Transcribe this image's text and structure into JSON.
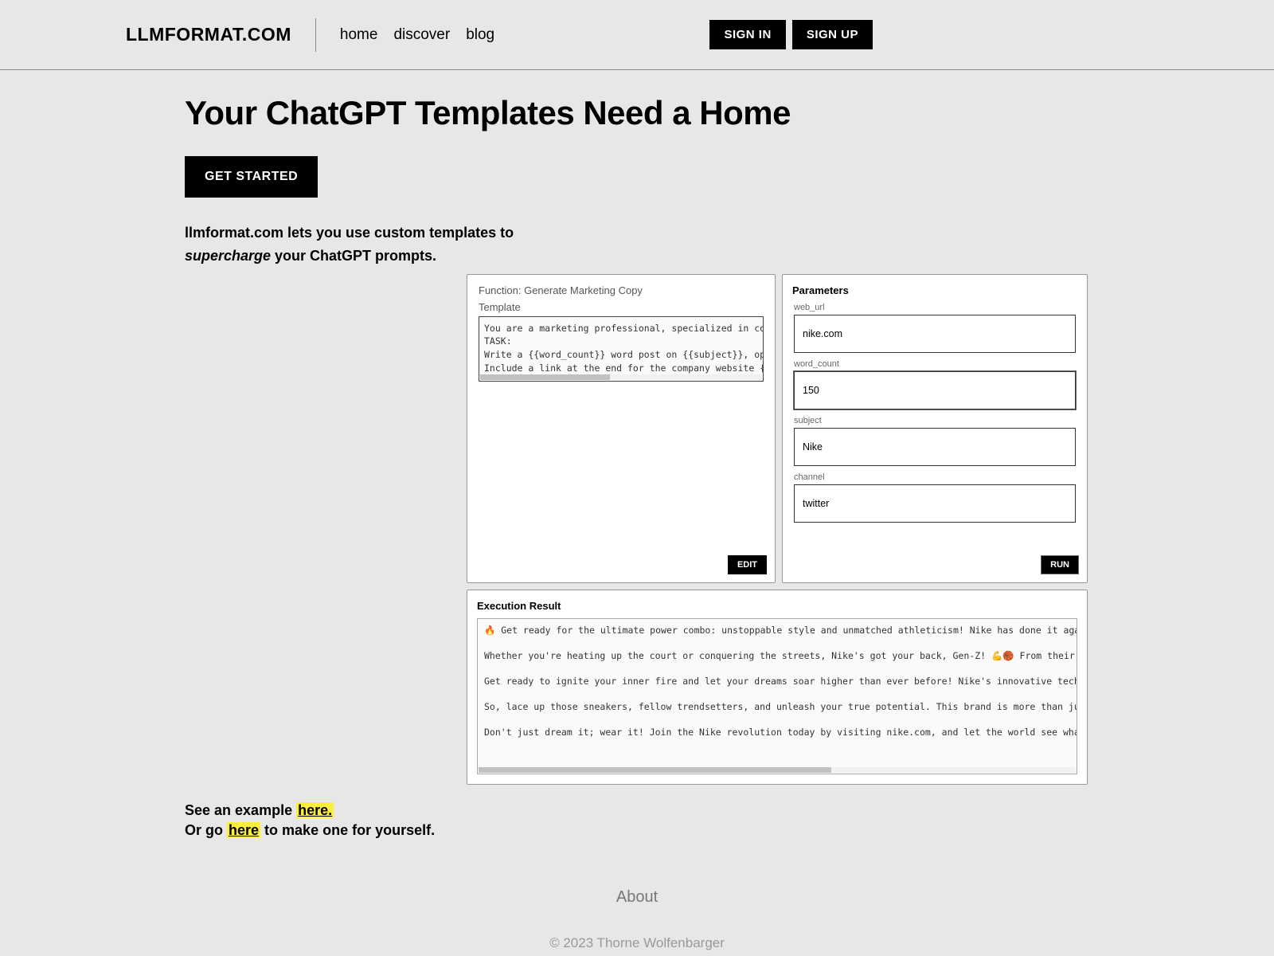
{
  "header": {
    "logo": "LLMFORMAT.COM",
    "nav": {
      "home": "home",
      "discover": "discover",
      "blog": "blog"
    },
    "signin": "SIGN IN",
    "signup": "SIGN UP"
  },
  "main": {
    "headline": "Your ChatGPT Templates Need a Home",
    "get_started": "GET STARTED",
    "tagline_prefix": "llmformat.com lets you use custom templates to ",
    "tagline_emph": "supercharge",
    "tagline_suffix": " your ChatGPT prompts."
  },
  "demo": {
    "function_title": "Function: Generate Marketing Copy",
    "template_label": "Template",
    "template_text": "You are a marketing professional, specialized in communicat\nTASK:\nWrite a {{word_count}} word post on {{subject}}, optimized \nInclude a link at the end for the company website {{web_url",
    "edit_label": "EDIT",
    "params_title": "Parameters",
    "params": {
      "web_url": {
        "label": "web_url",
        "value": "nike.com"
      },
      "word_count": {
        "label": "word_count",
        "value": "150"
      },
      "subject": {
        "label": "subject",
        "value": "Nike"
      },
      "channel": {
        "label": "channel",
        "value": "twitter"
      }
    },
    "run_label": "RUN",
    "result_title": "Execution Result",
    "result_text": "🔥 Get ready for the ultimate power combo: unstoppable style and unmatched athleticism! Nike has done it again, pushing boun\n\nWhether you're heating up the court or conquering the streets, Nike's got your back, Gen-Z! 💪🏀 From their game-changing A\n\nGet ready to ignite your inner fire and let your dreams soar higher than ever before! Nike's innovative technology keeps you\n\nSo, lace up those sneakers, fellow trendsetters, and unleash your true potential. This brand is more than just shoes—it's a \n\nDon't just dream it; wear it! Join the Nike revolution today by visiting nike.com, and let the world see what you're made of"
  },
  "bottom": {
    "see_example": "See an example ",
    "here1": "here.",
    "or_go": "Or go ",
    "here2": "here",
    "suffix": " to make one for yourself."
  },
  "footer": {
    "about": "About",
    "copyright": "© 2023 Thorne Wolfenbarger"
  }
}
